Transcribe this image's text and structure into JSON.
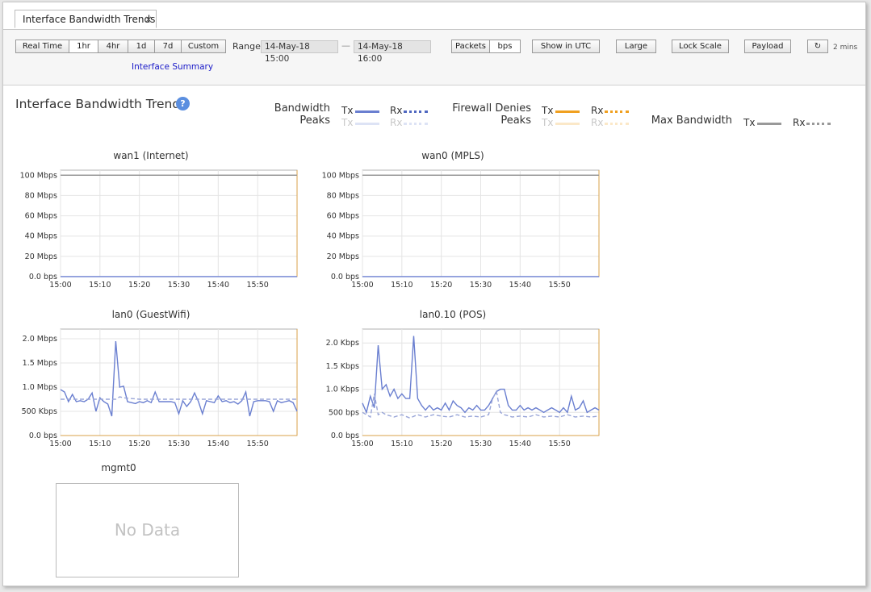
{
  "tab": {
    "label": "Interface Bandwidth Trends",
    "close": "×"
  },
  "toolbar": {
    "time_buttons": [
      "Real Time",
      "1hr",
      "4hr",
      "1d",
      "7d",
      "Custom"
    ],
    "selected": "1hr",
    "range_label": "Range",
    "range_start": "14-May-18 15:00",
    "range_sep": "—",
    "range_end": "14-May-18 16:00",
    "packets": "Packets",
    "bps": "bps",
    "show_utc": "Show in UTC",
    "large": "Large",
    "lock_scale": "Lock Scale",
    "payload": "Payload",
    "refresh_icon": "↻",
    "refresh_interval": "2 mins",
    "summary_link": "Interface Summary"
  },
  "page": {
    "title": "Interface Bandwidth Trends",
    "help": "?"
  },
  "legend": {
    "bandwidth": "Bandwidth",
    "peaks": "Peaks",
    "firewall_denies": "Firewall Denies",
    "peaks2": "Peaks",
    "max_bandwidth": "Max Bandwidth",
    "tx": "Tx",
    "rx": "Rx",
    "colors": {
      "bandwidth": "#6a7fd0",
      "firewall": "#f0a020",
      "max": "#999999",
      "peak_bw": "#dde3f5",
      "peak_fw": "#fbe8c8"
    }
  },
  "no_data": {
    "title": "mgmt0",
    "text": "No Data"
  },
  "chart_data": [
    {
      "type": "line",
      "title": "wan1 (Internet)",
      "x_ticks": [
        "15:00",
        "15:10",
        "15:20",
        "15:30",
        "15:40",
        "15:50"
      ],
      "y_ticks": [
        "100 Mbps",
        "80 Mbps",
        "60 Mbps",
        "40 Mbps",
        "20 Mbps",
        "0.0 bps"
      ],
      "y_tick_values": [
        100,
        80,
        60,
        40,
        20,
        0
      ],
      "ylim": [
        0,
        105
      ],
      "xlim": [
        0,
        60
      ],
      "y_unit": "Mbps",
      "series": [
        {
          "name": "Max Bandwidth",
          "color": "#999999",
          "x": [
            0,
            60
          ],
          "y": [
            100,
            100
          ]
        },
        {
          "name": "Bandwidth",
          "color": "#6a7fd0",
          "x": [
            0,
            60
          ],
          "y": [
            0.05,
            0.05
          ]
        }
      ]
    },
    {
      "type": "line",
      "title": "wan0 (MPLS)",
      "x_ticks": [
        "15:00",
        "15:10",
        "15:20",
        "15:30",
        "15:40",
        "15:50"
      ],
      "y_ticks": [
        "100 Mbps",
        "80 Mbps",
        "60 Mbps",
        "40 Mbps",
        "20 Mbps",
        "0.0 bps"
      ],
      "y_tick_values": [
        100,
        80,
        60,
        40,
        20,
        0
      ],
      "ylim": [
        0,
        105
      ],
      "xlim": [
        0,
        60
      ],
      "y_unit": "Mbps",
      "series": [
        {
          "name": "Max Bandwidth",
          "color": "#999999",
          "x": [
            0,
            60
          ],
          "y": [
            100,
            100
          ]
        },
        {
          "name": "Bandwidth",
          "color": "#6a7fd0",
          "x": [
            0,
            60
          ],
          "y": [
            0.05,
            0.05
          ]
        }
      ]
    },
    {
      "type": "line",
      "title": "lan0 (GuestWifi)",
      "x_ticks": [
        "15:00",
        "15:10",
        "15:20",
        "15:30",
        "15:40",
        "15:50"
      ],
      "y_ticks": [
        "2.0 Mbps",
        "1.5 Mbps",
        "1.0 Mbps",
        "500 Kbps",
        "0.0 bps"
      ],
      "y_tick_values": [
        2.0,
        1.5,
        1.0,
        0.5,
        0
      ],
      "ylim": [
        0,
        2.2
      ],
      "xlim": [
        0,
        60
      ],
      "y_unit": "Mbps",
      "series": [
        {
          "name": "Tx",
          "color": "#6a7fd0",
          "dashed": false,
          "x": [
            0,
            1,
            2,
            3,
            4,
            5,
            6,
            7,
            8,
            9,
            10,
            11,
            12,
            13,
            14,
            15,
            16,
            17,
            18,
            19,
            20,
            21,
            22,
            23,
            24,
            25,
            26,
            27,
            28,
            29,
            30,
            31,
            32,
            33,
            34,
            35,
            36,
            37,
            38,
            39,
            40,
            41,
            42,
            43,
            44,
            45,
            46,
            47,
            48,
            49,
            50,
            51,
            52,
            53,
            54,
            55,
            56,
            57,
            58,
            59,
            60
          ],
          "y": [
            0.95,
            0.9,
            0.7,
            0.85,
            0.7,
            0.72,
            0.7,
            0.75,
            0.88,
            0.5,
            0.78,
            0.7,
            0.65,
            0.4,
            1.95,
            1.0,
            1.02,
            0.7,
            0.68,
            0.66,
            0.7,
            0.68,
            0.72,
            0.68,
            0.9,
            0.7,
            0.7,
            0.7,
            0.7,
            0.68,
            0.45,
            0.72,
            0.6,
            0.7,
            0.88,
            0.7,
            0.45,
            0.72,
            0.7,
            0.68,
            0.82,
            0.7,
            0.72,
            0.68,
            0.7,
            0.65,
            0.72,
            0.9,
            0.4,
            0.7,
            0.72,
            0.72,
            0.72,
            0.7,
            0.5,
            0.72,
            0.68,
            0.7,
            0.72,
            0.68,
            0.5
          ]
        },
        {
          "name": "Rx",
          "color": "#9aa6d8",
          "dashed": true,
          "x": [
            0,
            10,
            14,
            15,
            16,
            20,
            30,
            40,
            50,
            60
          ],
          "y": [
            0.75,
            0.75,
            0.75,
            0.8,
            0.78,
            0.75,
            0.75,
            0.75,
            0.75,
            0.75
          ]
        }
      ]
    },
    {
      "type": "line",
      "title": "lan0.10 (POS)",
      "x_ticks": [
        "15:00",
        "15:10",
        "15:20",
        "15:30",
        "15:40",
        "15:50"
      ],
      "y_ticks": [
        "2.0 Kbps",
        "1.5 Kbps",
        "1.0 Kbps",
        "500 bps",
        "0.0 bps"
      ],
      "y_tick_values": [
        2.0,
        1.5,
        1.0,
        0.5,
        0
      ],
      "ylim": [
        0,
        2.3
      ],
      "xlim": [
        0,
        60
      ],
      "y_unit": "Kbps",
      "series": [
        {
          "name": "Tx",
          "color": "#6a7fd0",
          "dashed": false,
          "x": [
            0,
            1,
            2,
            3,
            4,
            5,
            6,
            7,
            8,
            9,
            10,
            11,
            12,
            13,
            14,
            15,
            16,
            17,
            18,
            19,
            20,
            21,
            22,
            23,
            24,
            25,
            26,
            27,
            28,
            29,
            30,
            31,
            32,
            33,
            34,
            35,
            36,
            37,
            38,
            39,
            40,
            41,
            42,
            43,
            44,
            45,
            46,
            47,
            48,
            49,
            50,
            51,
            52,
            53,
            54,
            55,
            56,
            57,
            58,
            59,
            60
          ],
          "y": [
            0.7,
            0.5,
            0.85,
            0.6,
            1.95,
            1.0,
            1.1,
            0.85,
            1.0,
            0.8,
            0.9,
            0.8,
            0.8,
            2.15,
            0.8,
            0.65,
            0.55,
            0.65,
            0.55,
            0.6,
            0.55,
            0.7,
            0.55,
            0.75,
            0.65,
            0.6,
            0.5,
            0.6,
            0.55,
            0.65,
            0.55,
            0.55,
            0.65,
            0.8,
            0.95,
            1.0,
            1.0,
            0.65,
            0.55,
            0.55,
            0.65,
            0.55,
            0.6,
            0.55,
            0.6,
            0.55,
            0.5,
            0.55,
            0.6,
            0.55,
            0.5,
            0.6,
            0.5,
            0.85,
            0.55,
            0.6,
            0.75,
            0.5,
            0.55,
            0.6,
            0.55
          ]
        },
        {
          "name": "Rx",
          "color": "#9aa6d8",
          "dashed": true,
          "x": [
            0,
            2,
            3,
            4,
            5,
            6,
            8,
            10,
            12,
            14,
            16,
            18,
            20,
            22,
            24,
            26,
            28,
            30,
            32,
            33,
            34,
            35,
            36,
            38,
            40,
            42,
            44,
            46,
            48,
            50,
            52,
            54,
            56,
            58,
            60
          ],
          "y": [
            0.5,
            0.4,
            0.9,
            0.45,
            0.5,
            0.45,
            0.4,
            0.45,
            0.38,
            0.45,
            0.4,
            0.45,
            0.42,
            0.4,
            0.45,
            0.4,
            0.42,
            0.4,
            0.45,
            0.8,
            0.95,
            0.5,
            0.45,
            0.4,
            0.42,
            0.4,
            0.45,
            0.4,
            0.42,
            0.4,
            0.45,
            0.4,
            0.42,
            0.4,
            0.42
          ]
        }
      ]
    }
  ]
}
